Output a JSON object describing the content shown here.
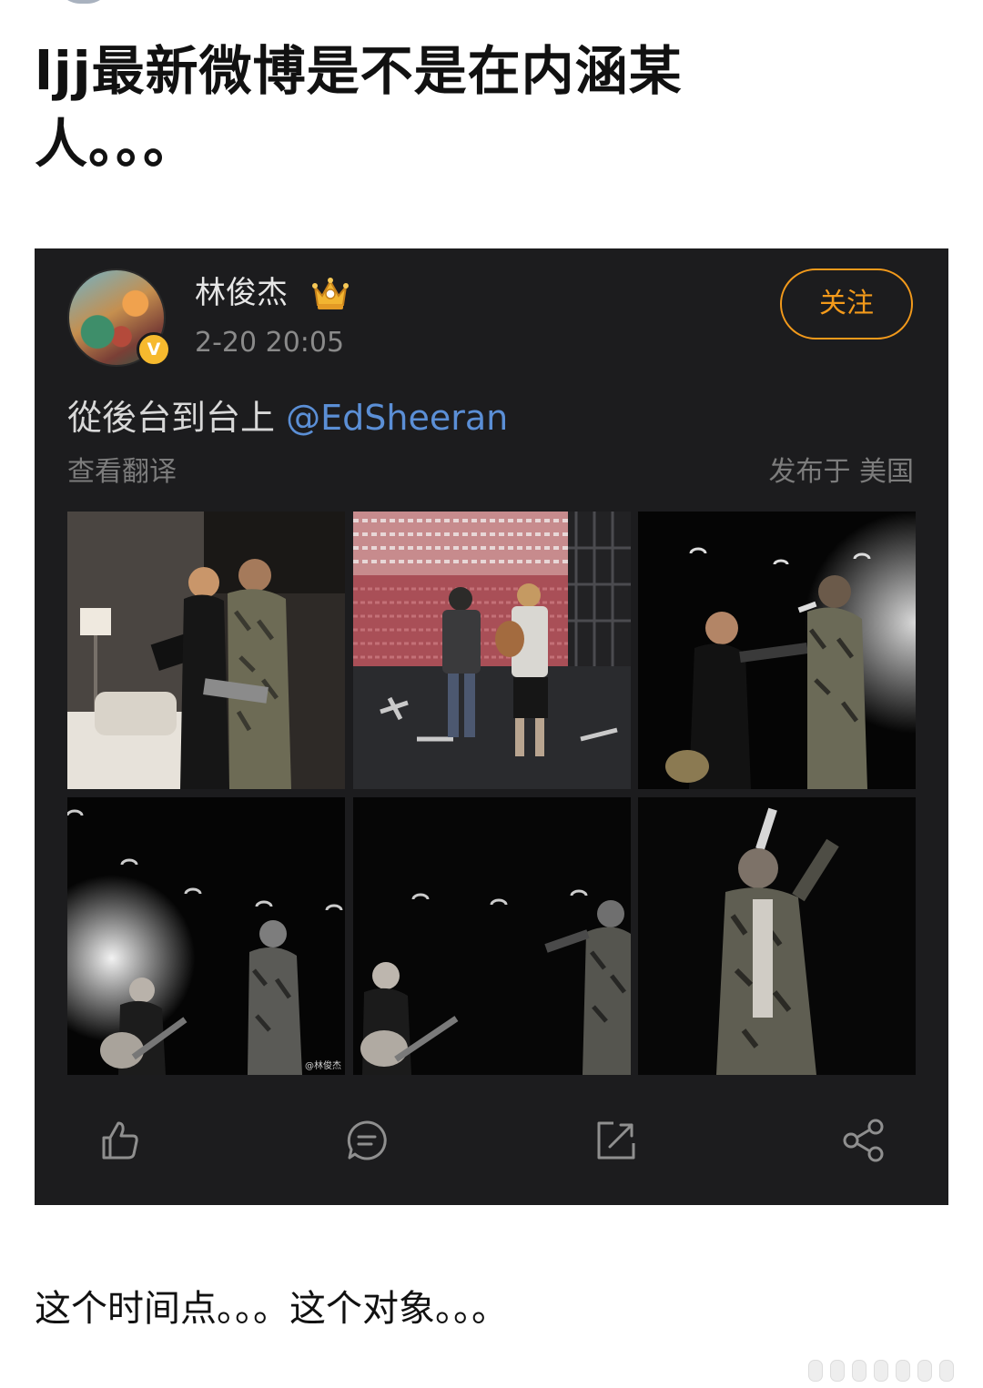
{
  "post": {
    "title": "ljj最新微博是不是在内涵某人。。。",
    "caption": "这个时间点。。。这个对象。。。"
  },
  "weibo_card": {
    "user_name": "林俊杰",
    "verified_mark": "V",
    "timestamp": "2-20 20:05",
    "follow_label": "关注",
    "text": "從後台到台上",
    "mention": "@EdSheeran",
    "translate_label": "查看翻译",
    "location_label": "发布于 美国",
    "watermark": "@林俊杰",
    "photos": [
      "photo-backstage",
      "photo-stadium",
      "photo-stage-duet",
      "photo-spotlight-guitar",
      "photo-stage-singing",
      "photo-solo-performance"
    ],
    "actions": [
      "like-icon",
      "comment-icon",
      "repost-icon",
      "share-icon"
    ]
  },
  "colors": {
    "card_background": "#1c1c1e",
    "follow_accent": "#f39a1b",
    "mention_link": "#5b8fd6",
    "verified_badge": "#f6b92e"
  }
}
